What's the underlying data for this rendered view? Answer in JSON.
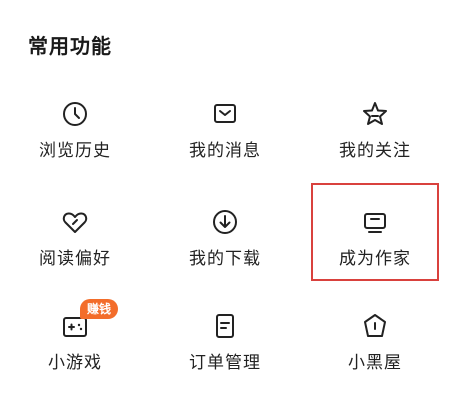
{
  "section": {
    "title": "常用功能"
  },
  "items": [
    {
      "label": "浏览历史",
      "icon": "clock-icon"
    },
    {
      "label": "我的消息",
      "icon": "message-box-icon"
    },
    {
      "label": "我的关注",
      "icon": "star-icon"
    },
    {
      "label": "阅读偏好",
      "icon": "heart-icon"
    },
    {
      "label": "我的下载",
      "icon": "download-icon"
    },
    {
      "label": "成为作家",
      "icon": "monitor-icon"
    },
    {
      "label": "小游戏",
      "icon": "gamepad-icon",
      "badge": "赚钱"
    },
    {
      "label": "订单管理",
      "icon": "order-doc-icon"
    },
    {
      "label": "小黑屋",
      "icon": "house-pentagon-icon"
    }
  ],
  "colors": {
    "highlight_border": "#d9413d",
    "badge_bg": "#f36d2a",
    "icon_stroke": "#222222"
  }
}
